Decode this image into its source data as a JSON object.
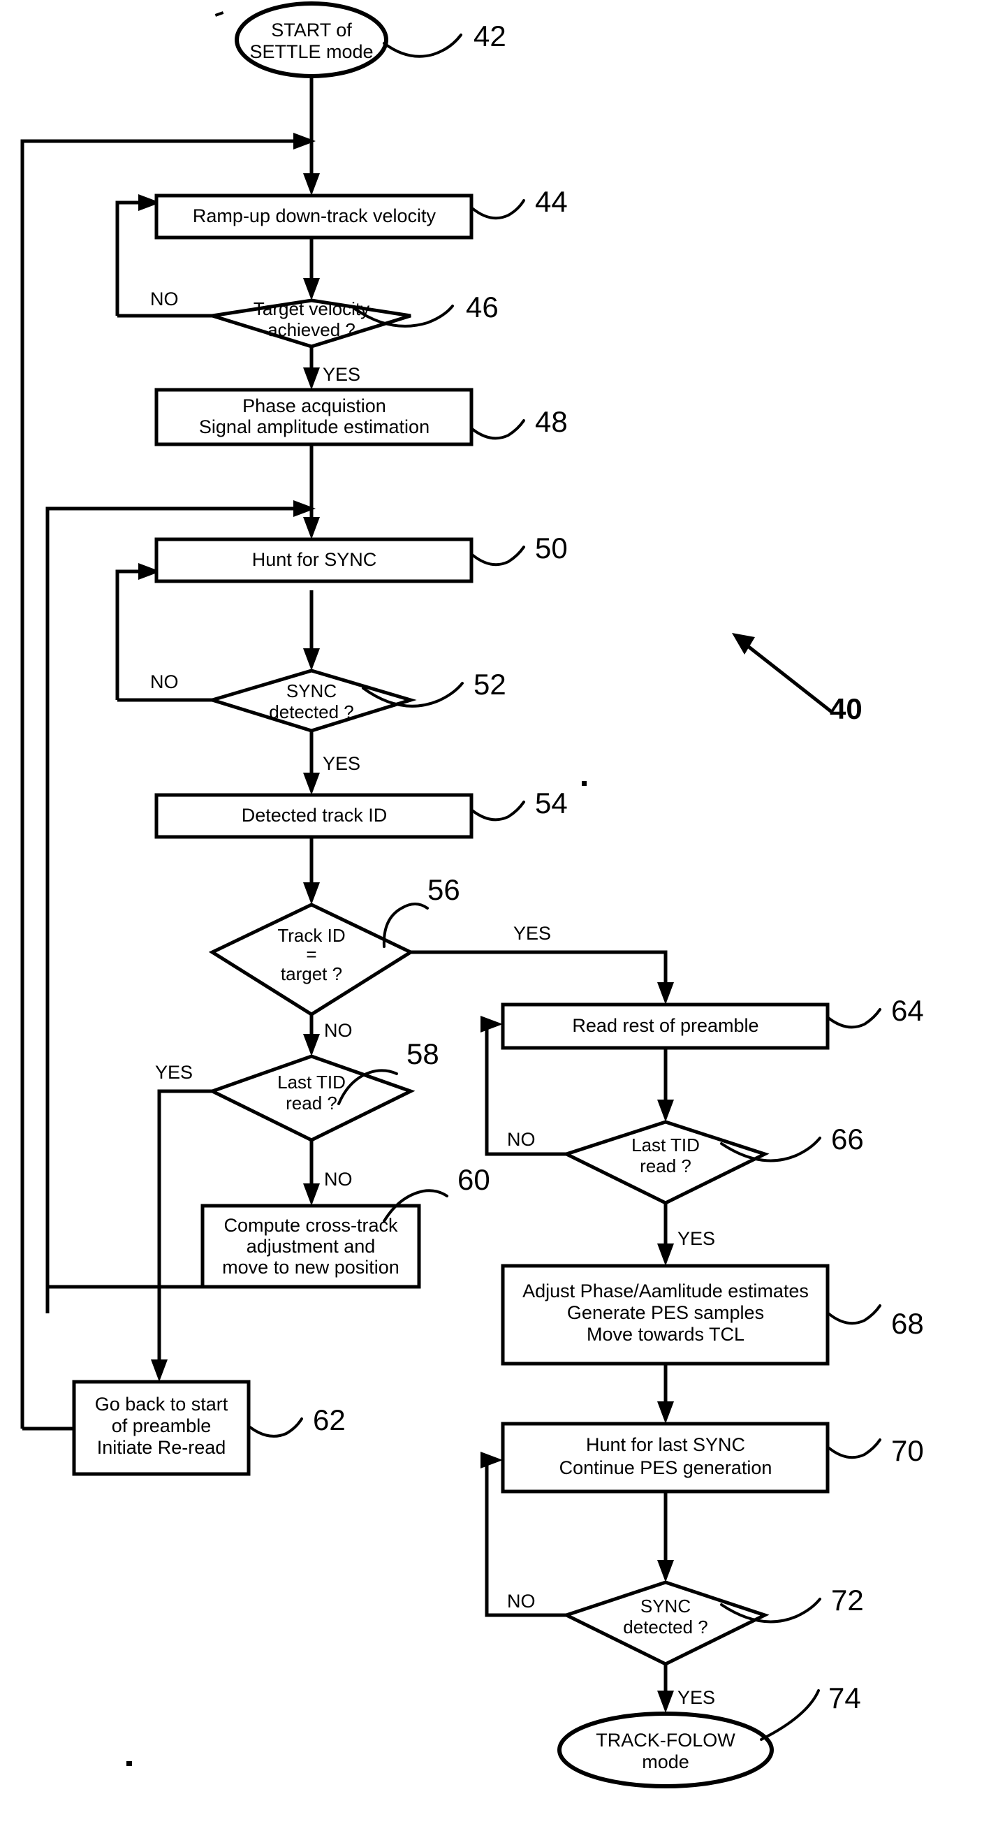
{
  "figure": {
    "reference_numeral": "40",
    "type": "patent-flowchart"
  },
  "nodes": {
    "start": {
      "ref": "42",
      "shape": "terminator-oval",
      "lines": [
        "START of",
        "SETTLE mode"
      ]
    },
    "ramp_up": {
      "ref": "44",
      "shape": "process-box",
      "lines": [
        "Ramp-up down-track velocity"
      ]
    },
    "target_velocity": {
      "ref": "46",
      "shape": "decision-diamond",
      "lines": [
        "Target velocity",
        "achieved ?"
      ],
      "yes_label": "YES",
      "no_label": "NO"
    },
    "phase_acq": {
      "ref": "48",
      "shape": "process-box",
      "lines": [
        "Phase acquistion",
        "Signal amplitude estimation"
      ]
    },
    "hunt_sync": {
      "ref": "50",
      "shape": "process-box",
      "lines": [
        "Hunt for SYNC"
      ]
    },
    "sync_detected": {
      "ref": "52",
      "shape": "decision-diamond",
      "lines": [
        "SYNC",
        "detected ?"
      ],
      "yes_label": "YES",
      "no_label": "NO"
    },
    "detected_track_id": {
      "ref": "54",
      "shape": "process-box",
      "lines": [
        "Detected track ID"
      ]
    },
    "track_id_target": {
      "ref": "56",
      "shape": "decision-diamond",
      "lines": [
        "Track ID",
        "=",
        "target ?"
      ],
      "yes_label": "YES",
      "no_label": "NO"
    },
    "last_tid_read_left": {
      "ref": "58",
      "shape": "decision-diamond",
      "lines": [
        "Last TID",
        "read ?"
      ],
      "yes_label": "YES",
      "no_label": "NO"
    },
    "compute_cross_track": {
      "ref": "60",
      "shape": "process-box",
      "lines": [
        "Compute cross-track",
        "adjustment and",
        "move to new position"
      ]
    },
    "go_back_start": {
      "ref": "62",
      "shape": "process-box",
      "lines": [
        "Go back to start",
        "of preamble",
        "Initiate Re-read"
      ]
    },
    "read_rest_preamble": {
      "ref": "64",
      "shape": "process-box",
      "lines": [
        "Read rest of preamble"
      ]
    },
    "last_tid_read_right": {
      "ref": "66",
      "shape": "decision-diamond",
      "lines": [
        "Last TID",
        "read ?"
      ],
      "yes_label": "YES",
      "no_label": "NO"
    },
    "adjust_phase": {
      "ref": "68",
      "shape": "process-box",
      "lines": [
        "Adjust Phase/Aamlitude estimates",
        "Generate PES samples",
        "Move towards TCL"
      ]
    },
    "hunt_last_sync": {
      "ref": "70",
      "shape": "process-box",
      "lines": [
        "Hunt for last SYNC",
        "Continue PES generation"
      ]
    },
    "sync_detected_2": {
      "ref": "72",
      "shape": "decision-diamond",
      "lines": [
        "SYNC",
        "detected ?"
      ],
      "yes_label": "YES",
      "no_label": "NO"
    },
    "track_follow": {
      "ref": "74",
      "shape": "terminator-oval",
      "lines": [
        "TRACK-FOLOW",
        "mode"
      ]
    }
  },
  "colors": {
    "stroke": "#000000",
    "fill": "#ffffff",
    "text": "#000000"
  }
}
